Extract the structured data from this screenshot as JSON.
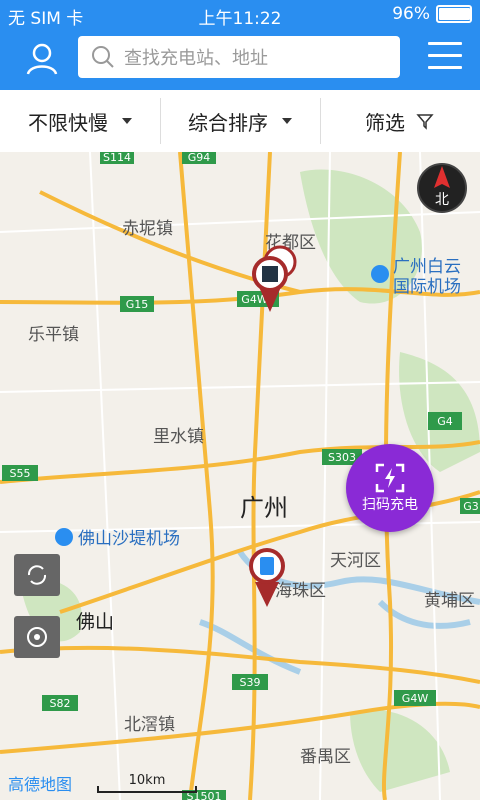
{
  "status_bar": {
    "carrier": "无 SIM 卡",
    "time": "上午11:22",
    "battery": "96%",
    "battery_level": 0.96
  },
  "header": {
    "search_placeholder": "查找充电站、地址"
  },
  "filters": [
    {
      "label": "不限快慢"
    },
    {
      "label": "综合排序"
    },
    {
      "label": "筛选"
    }
  ],
  "map": {
    "places": {
      "chini": "赤坭镇",
      "huadu": "花都区",
      "airport1": "广州白云",
      "airport2": "国际机场",
      "leping": "乐平镇",
      "lishui": "里水镇",
      "guangzhou": "广州",
      "foshan_airport": "佛山沙堤机场",
      "tianhe": "天河区",
      "haizhu": "海珠区",
      "huangpu": "黄埔区",
      "foshan": "佛山",
      "beijiao": "北滘镇",
      "panyu": "番禺区"
    },
    "roads": {
      "s114": "S114",
      "g94": "G94",
      "g15": "G15",
      "g4w2": "G4W2",
      "s303": "S303",
      "s55": "S55",
      "g4a": "G4",
      "g4b": "G4",
      "s39": "S39",
      "s82": "S82",
      "g4w": "G4W",
      "g3": "G3",
      "s1501": "S1501"
    },
    "compass_label": "北",
    "logo": "高德地图",
    "scale": "10km"
  },
  "scan_button": {
    "label": "扫码充电"
  }
}
